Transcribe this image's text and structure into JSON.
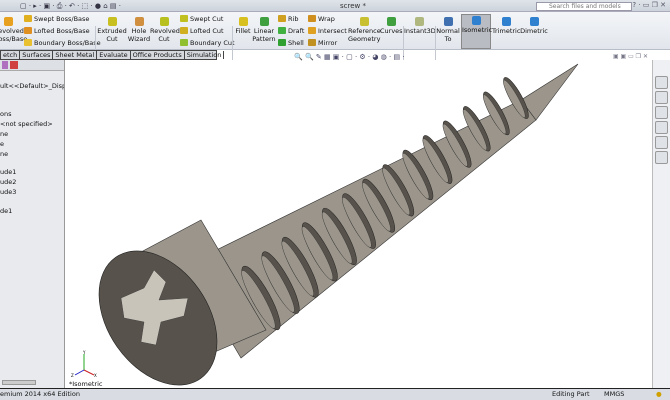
{
  "window": {
    "title": "screw *",
    "search_placeholder": "Search files and models",
    "help": "?"
  },
  "ribbon": {
    "revolved_boss": "Revolved\nBoss/Base",
    "swept_boss": "Swept Boss/Base",
    "lofted_boss": "Lofted Boss/Base",
    "boundary_boss": "Boundary Boss/Base",
    "extruded_cut": "Extruded\nCut",
    "hole_wizard": "Hole\nWizard",
    "revolved_cut": "Revolved\nCut",
    "swept_cut": "Swept Cut",
    "lofted_cut": "Lofted Cut",
    "boundary_cut": "Boundary Cut",
    "fillet": "Fillet",
    "linear_pattern": "Linear\nPattern",
    "rib": "Rib",
    "draft": "Draft",
    "shell": "Shell",
    "wrap": "Wrap",
    "intersect": "Intersect",
    "mirror": "Mirror",
    "reference_geometry": "Reference\nGeometry",
    "curves": "Curves",
    "instant3d": "Instant3D",
    "normal_to": "Normal\nTo",
    "isometric": "Isometric",
    "trimetric": "Trimetric",
    "dimetric": "Dimetric"
  },
  "tabs": [
    "etch",
    "Surfaces",
    "Sheet Metal",
    "Evaluate",
    "Office Products",
    "Simulation"
  ],
  "tree": [
    "ult<<Default>_Displa",
    "ons",
    "<not specified>",
    "ne",
    "e",
    "ne",
    "ude1",
    "ude2",
    "ude3",
    "de1"
  ],
  "viewport": {
    "view_label": "*Isometric",
    "axes": {
      "x": "X",
      "y": "Y",
      "z": "Z"
    },
    "part_color": "#9b958b",
    "dark_color": "#57524b"
  },
  "status": {
    "edition": "emium 2014 x64 Edition",
    "mode": "Editing Part",
    "units": "MMGS"
  }
}
